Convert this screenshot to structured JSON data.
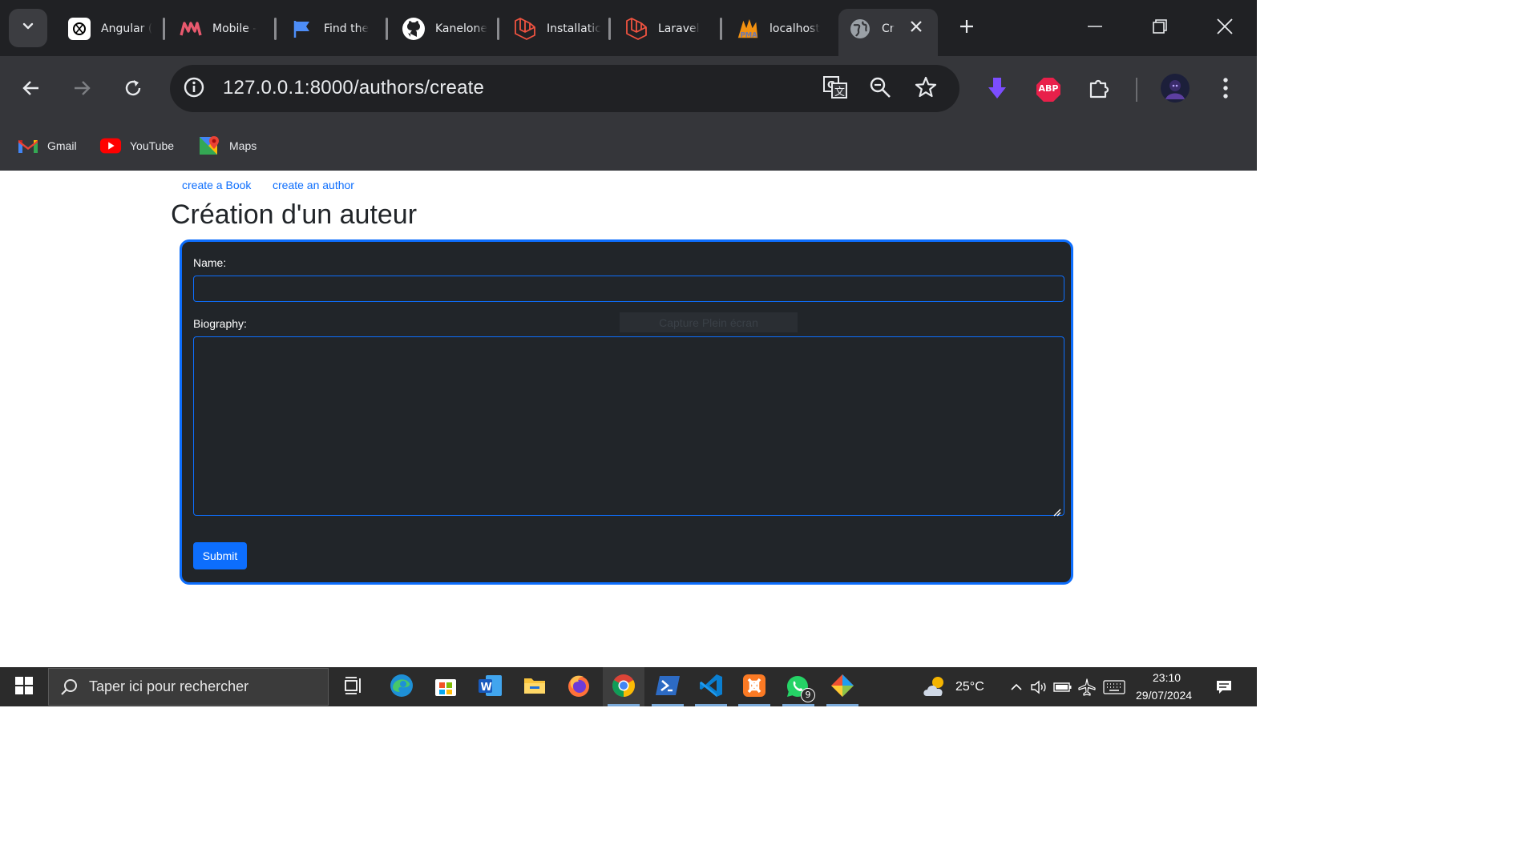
{
  "browser": {
    "tabs": [
      {
        "title": "Angular (",
        "icon": "openai-icon"
      },
      {
        "title": "Mobile -",
        "icon": "m-logo-icon"
      },
      {
        "title": "Find the",
        "icon": "flag-icon"
      },
      {
        "title": "Kanelone",
        "icon": "github-icon"
      },
      {
        "title": "Installatic",
        "icon": "laravel-icon"
      },
      {
        "title": "Laravel",
        "icon": "laravel-icon"
      },
      {
        "title": "localhost",
        "icon": "phpmyadmin-icon"
      },
      {
        "title": "Cr",
        "icon": "globe-icon",
        "active": true
      }
    ],
    "url": "127.0.0.1:8000/authors/create",
    "bookmarks": [
      {
        "label": "Gmail",
        "icon": "gmail-icon"
      },
      {
        "label": "YouTube",
        "icon": "youtube-icon"
      },
      {
        "label": "Maps",
        "icon": "maps-icon"
      }
    ],
    "extensions": {
      "abp": "ABP"
    },
    "colors": {
      "tabstrip": "#202124",
      "toolbar": "#35363a"
    }
  },
  "page": {
    "nav_links": [
      "create a Book",
      "create an author"
    ],
    "title": "Création d'un auteur",
    "form": {
      "name_label": "Name:",
      "name_value": "",
      "bio_label": "Biography:",
      "bio_value": "",
      "submit_label": "Submit"
    },
    "overlay_text": "Capture Plein écran",
    "colors": {
      "accent": "#0d6efd",
      "card": "#212529"
    }
  },
  "taskbar": {
    "search_placeholder": "Taper ici pour rechercher",
    "apps": [
      "task-view",
      "edge",
      "store",
      "word",
      "file-explorer",
      "firefox",
      "chrome",
      "powershell",
      "vscode",
      "xampp",
      "whatsapp",
      "git"
    ],
    "whatsapp_badge": "9",
    "weather": "25°C",
    "time": "23:10",
    "date": "29/07/2024"
  }
}
